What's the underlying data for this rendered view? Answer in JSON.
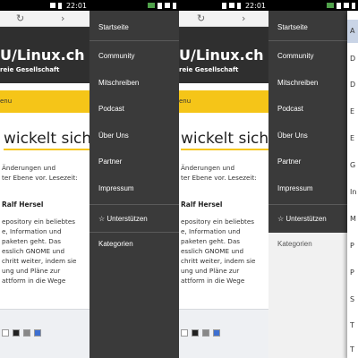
{
  "status": {
    "time": "22:01"
  },
  "toolbar": {
    "reload_glyph": "↻",
    "forward_glyph": "›"
  },
  "site": {
    "title_fragment": "U/Linux.ch",
    "subtitle_fragment": "reie Gesellschaft",
    "menu_fragment": "enu"
  },
  "article": {
    "headline_fragment": "wickelt sich",
    "lines": [
      "Änderungen und",
      "ter Ebene vor. Lesezeit:"
    ],
    "author_fragment": "Ralf Hersel",
    "body_lines": [
      "epository ein beliebtes",
      "e, Information und",
      "paketen geht. Das",
      "esslich GNOME und",
      "chritt weiter, indem sie",
      "ung und Pläne zur",
      "attform in die Wege"
    ]
  },
  "drawer": {
    "items": [
      "Startseite",
      "Community",
      "Mitschreiben",
      "Podcast",
      "Über Uns",
      "Partner",
      "Impressum",
      "☆ Unterstützen",
      "Kategorien"
    ]
  },
  "dropdown": {
    "items": [
      "A",
      "D",
      "D",
      "E",
      "E",
      "G",
      "In",
      "M",
      "P",
      "P",
      "S",
      "T",
      "T"
    ],
    "active_color": "#c9d4e6"
  },
  "colors": {
    "header_bg": "#2f2f2f",
    "accent_yellow": "#f5c518",
    "drawer_bg": "#3a3a3a",
    "status_green": "#4fa14a"
  }
}
